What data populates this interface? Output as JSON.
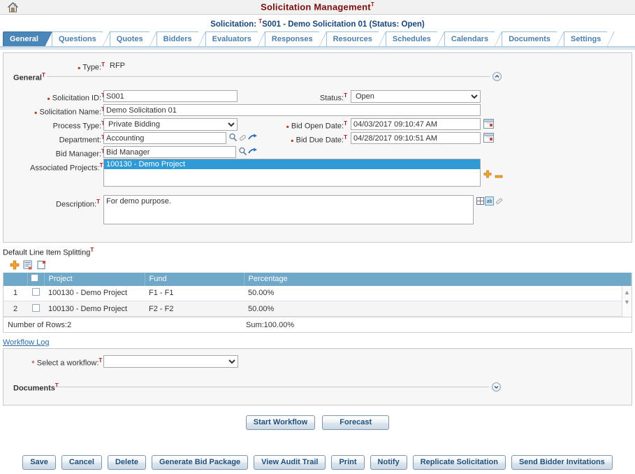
{
  "app": {
    "title": "Solicitation Management",
    "home_icon": "home-icon",
    "sup_mark": "T"
  },
  "subtitle": {
    "prefix": "Solicitation:",
    "mark": "T",
    "text": "S001 - Demo Solicitation 01 (Status: Open)"
  },
  "tabs": [
    {
      "label": "General",
      "active": true
    },
    {
      "label": "Questions",
      "active": false
    },
    {
      "label": "Quotes",
      "active": false
    },
    {
      "label": "Bidders",
      "active": false
    },
    {
      "label": "Evaluators",
      "active": false
    },
    {
      "label": "Responses",
      "active": false
    },
    {
      "label": "Resources",
      "active": false
    },
    {
      "label": "Schedules",
      "active": false
    },
    {
      "label": "Calendars",
      "active": false
    },
    {
      "label": "Documents",
      "active": false
    },
    {
      "label": "Settings",
      "active": false
    }
  ],
  "form": {
    "type_label": "Type:",
    "type_value": "RFP",
    "group_title": "General",
    "collapse_icon": "chevron-up-icon",
    "solicitation_id_label": "Solicitation ID:",
    "solicitation_id_value": "S001",
    "solicitation_name_label": "Solicitation Name:",
    "solicitation_name_value": "Demo Solicitation 01",
    "process_type_label": "Process Type:",
    "process_type_value": "Private Bidding",
    "process_type_options": [
      "Private Bidding"
    ],
    "department_label": "Department:",
    "department_value": "Accounting",
    "bid_manager_label": "Bid Manager:",
    "bid_manager_value": "Bid Manager",
    "associated_projects_label": "Associated Projects:",
    "associated_projects_items": [
      "100130 - Demo Project"
    ],
    "description_label": "Description:",
    "description_value": "For demo purpose.",
    "status_label": "Status:",
    "status_value": "Open",
    "status_options": [
      "Open"
    ],
    "bid_open_date_label": "Bid Open Date:",
    "bid_open_date_value": "04/03/2017 09:10:47 AM",
    "bid_due_date_label": "Bid Due Date:",
    "bid_due_date_value": "04/28/2017 09:10:51 AM",
    "icons": {
      "search": "search-icon",
      "erase": "eraser-icon",
      "goto": "arrow-right-icon",
      "calendar": "calendar-icon",
      "add": "plus-icon",
      "remove": "minus-icon",
      "table": "table-icon",
      "spellcheck": "spellcheck-icon",
      "pencil": "pencil-icon"
    }
  },
  "splitting": {
    "section_title": "Default Line Item Splitting",
    "mark": "T",
    "toolbar": [
      {
        "name": "add-row-icon",
        "title": "Add"
      },
      {
        "name": "delete-row-icon",
        "title": "Delete"
      },
      {
        "name": "copy-row-icon",
        "title": "Copy"
      }
    ],
    "columns": [
      "",
      "",
      "Project",
      "Fund",
      "Percentage"
    ],
    "rows": [
      {
        "num": "1",
        "project": "100130 - Demo Project",
        "fund": "F1 - F1",
        "percentage": "50.00%"
      },
      {
        "num": "2",
        "project": "100130 - Demo Project",
        "fund": "F2 - F2",
        "percentage": "50.00%"
      }
    ],
    "footer_rows": "Number of Rows:2",
    "footer_sum": "Sum:100.00%",
    "scroll_up_icon": "chevron-up-icon",
    "scroll_down_icon": "chevron-down-icon"
  },
  "workflow": {
    "link_label": "Workflow Log",
    "select_label": "Select a workflow:",
    "select_value": "",
    "select_options": [
      ""
    ],
    "documents_label": "Documents",
    "documents_mark": "T",
    "expand_icon": "chevron-down-icon",
    "start_button": "Start Workflow",
    "forecast_button": "Forecast"
  },
  "footer_buttons": [
    "Save",
    "Cancel",
    "Delete",
    "Generate Bid Package",
    "View Audit Trail",
    "Print",
    "Notify",
    "Replicate Solicitation",
    "Send Bidder Invitations"
  ],
  "colors": {
    "title_red": "#7a0d0d",
    "subtitle_blue": "#17457a",
    "tab_active": "#4a87b8",
    "grid_header": "#6fa8c8",
    "selection_blue": "#2e9bd6",
    "required_red": "#c0392b",
    "icon_orange": "#e8a33d"
  }
}
